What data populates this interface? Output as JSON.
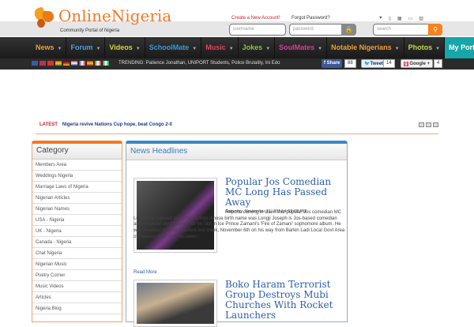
{
  "header": {
    "logo_title": "OnlineNigeria",
    "logo_subtitle": "Community Portal of Nigeria",
    "create_account": "Create a New Account!",
    "forgot_password": "Forgot Password?",
    "username_placeholder": "username",
    "password_placeholder": "password",
    "search_placeholder": "search"
  },
  "nav": [
    {
      "label": "News",
      "color": "#e8a13a"
    },
    {
      "label": "Forum",
      "color": "#4aa3df"
    },
    {
      "label": "Videos",
      "color": "#d8d83a"
    },
    {
      "label": "SchoolMate",
      "color": "#3a9bd6"
    },
    {
      "label": "Music",
      "color": "#e0465b"
    },
    {
      "label": "Jokes",
      "color": "#8dc63f"
    },
    {
      "label": "SoulMates",
      "color": "#d8408f"
    },
    {
      "label": "Notable Nigerians",
      "color": "#f0a030"
    },
    {
      "label": "Photos",
      "color": "#c8d84a"
    },
    {
      "label": "My Portal",
      "color": "#ffffff"
    }
  ],
  "trending": "TRENDING: Patience Jonathan, UNIPORT Students, Police Brutality, Ini Edo",
  "social": {
    "share": "Share",
    "share_count": "88",
    "tweet": "Tweet",
    "tweet_count": "14",
    "google": "Google +",
    "google_count": "4"
  },
  "latest": {
    "label": "LATEST",
    "headline": "Nigeria revive Nations Cup hope, beat Congo 2-0"
  },
  "category": {
    "title": "Category",
    "items": [
      "Members Area",
      "Weddings Nigeria",
      "Marriage Laws of Nigeria",
      "Nigerian Articles",
      "Nigerian Names",
      "USA - Nigeria",
      "UK - Nigeria",
      "Canada - Nigeria",
      "Chat Nigeria",
      "Nigerian Music",
      "Poetry Corner",
      "Music Videos",
      "Articles",
      "Nigeria Blog"
    ]
  },
  "news": {
    "title": "News Headlines",
    "articles": [
      {
        "title": "Popular Jos Comedian MC Long Has Passed Away",
        "date": "Saturday, November 15, 2014 4:53:00 PM",
        "body": "Reports coming in claim that popular Jos comedian MC Longs has passed away. MC Longs whose birth name was Longji Joseph is Jos-based comedian and musician very popular for his skit in Ice Prince Zamani's 'Fire of Zamani' sophomore album. He was involved in a car accident last week, November 6th on his way from Barkin Ladi Local Govt Area of Plateau state and has been i",
        "more": "Read More"
      },
      {
        "title": "Boko Haram Terrorist Group Destroys Mubi Churches With Rocket Launchers"
      }
    ]
  }
}
